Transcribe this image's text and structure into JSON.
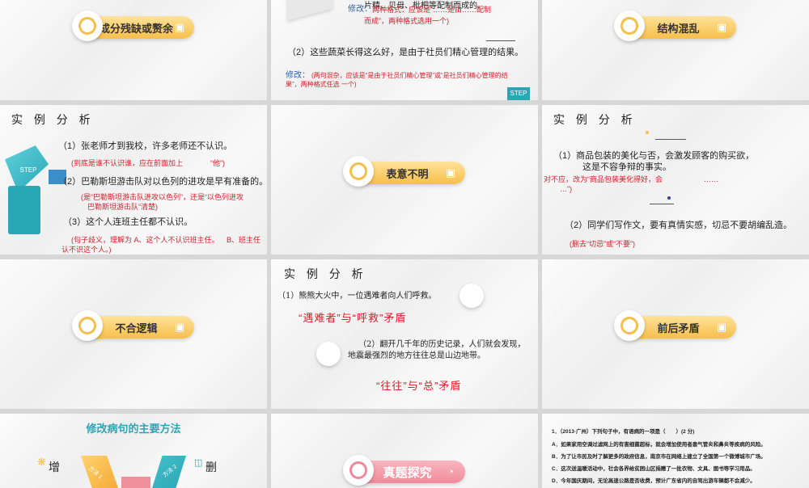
{
  "slides": {
    "s1": {
      "pill": "成分残缺或赘余"
    },
    "s2": {
      "sentence1_tail": "片精、贝母、枇杷等配制而成的。",
      "fix1_label": "修改：",
      "fix1_text": "两种格式：应该是“……是由……配制",
      "fix1_text2": "而成”，两种格式选用一个)",
      "sentence2": "（2）这些蔬菜长得这么好，是由于社员们精心管理的结果。",
      "fix2_label": "修改：",
      "fix2_text": "(两句混杂，应该是“是由于社员们精心管理”或“是社员们精心管理的结",
      "fix2_text2": "果”，两种格式任选 一个)",
      "step": "STEP"
    },
    "s3": {
      "pill": "结构混乱"
    },
    "s4": {
      "header": "实 例 分 析",
      "l1": "（1）张老师才到我校，许多老师还不认识。",
      "c1": "(到底是谁不认识谁，应在前面加上",
      "c1b": "“他”)",
      "l2": "（2）巴勒斯坦游击队对以色列的进攻是早有准备的。",
      "c2": "(是“巴勒斯坦游击队进攻以色列”，还是“以色列进攻",
      "c2b": "巴勒斯坦游击队”清楚)",
      "l3": "（3）这个人连班主任都不认识。",
      "c3": "(句子歧义，理解为 A、这个人不认识班主任。",
      "c3b": "B、班主任",
      "c3c": "认不识这个人。)",
      "step": "STEP"
    },
    "s5": {
      "pill": "表意不明"
    },
    "s6": {
      "header": "实 例 分 析",
      "l1": "（1）商品包装的美化与否，会激发顾客的购买欲，",
      "l1b": "这是不容争辩的事实。",
      "c1": "对不应，改为“商品包装美化得好，会",
      "c1b": "……",
      "c1c": "…”)",
      "l2": "（2）同学们写作文，要有真情实感，切忌不要胡编乱造。",
      "c2": "(删去“切忌”或“不要”)"
    },
    "s7": {
      "pill": "不合逻辑"
    },
    "s8": {
      "header": "实 例 分 析",
      "l1": "（1）熊熊大火中，一位遇难者向人们呼救。",
      "a1": "“遇难者”与“呼救”矛盾",
      "l2": "（2）翻开几千年的历史记录，人们就会发现，",
      "l2b": "地震最强烈的地方往往总是山边地带。",
      "a2": "“往往”与“总”矛盾"
    },
    "s9": {
      "pill": "前后矛盾"
    },
    "s10": {
      "title": "修改病句的主要方法",
      "add": "增",
      "del": "删",
      "m1": "方法 1",
      "m2": "方法 2"
    },
    "s11": {
      "pill": "真题探究"
    },
    "s12": {
      "q": "1．（2013·广州）下列句子中，有语病的一项是（　　）(2 分)",
      "qsrc": "(2013·广州)",
      "a": "A．如果家用空调过滤网上的有害细菌超标，就会增加使用者患气管炎和鼻炎等疾病的风险。",
      "b": "B．为了让市民及时了解更多的政府信息，南京市在网络上建立了全国第一个微博城市广场。",
      "c": "C．这次送温暖活动中，社会各界给贫困山区捐赠了一批衣物、文具、图书等学习用品。",
      "d": "D．今年国庆期间，无论高速公路是否收费，预计广东省内的自驾出游车辆都不会减少。"
    }
  },
  "colors": {
    "accent": "#f6bf4a",
    "red": "#d6202a",
    "blue": "#2f5fb0",
    "teal": "#2aa7b5",
    "pink": "#f08a9a"
  }
}
